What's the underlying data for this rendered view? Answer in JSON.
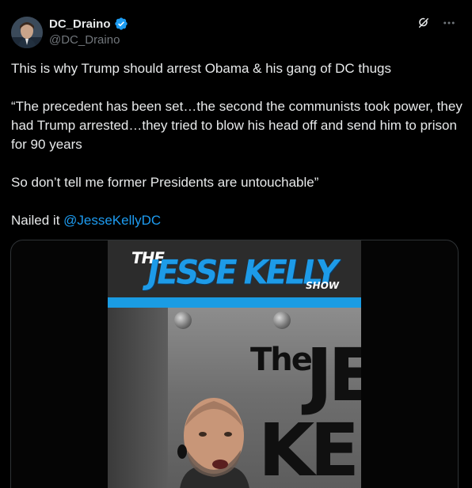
{
  "author": {
    "display_name": "DC_Draino",
    "handle": "@DC_Draino",
    "verified": true,
    "avatar_icon": "avatar-photo"
  },
  "actions": {
    "grok_icon": "grok-icon",
    "more_icon": "more-icon"
  },
  "post": {
    "line1": "This is why Trump should arrest Obama & his gang of DC thugs",
    "quote": "“The precedent has been set…the second the communists took power, they had Trump arrested…they tried to blow his head off and send him to prison for 90 years",
    "line3": "So don’t tell me former Presidents are untouchable”",
    "nailed_prefix": "Nailed it ",
    "mention": "@JesseKellyDC"
  },
  "media": {
    "type": "video",
    "banner_the": "THE",
    "banner_main": "JESSE KELLY",
    "banner_show": "SHOW",
    "sign_the": "The",
    "sign_line1": "JE",
    "sign_line2": "KEL"
  },
  "colors": {
    "background": "#000000",
    "text": "#e7e9ea",
    "secondary": "#71767b",
    "link": "#1d9bf0",
    "verified": "#1d9bf0",
    "border": "#2f3336"
  }
}
